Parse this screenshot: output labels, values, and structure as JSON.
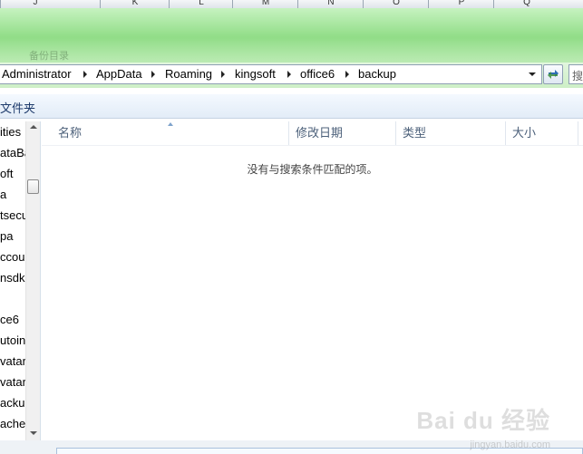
{
  "spreadsheet": {
    "columns": [
      "J",
      "K",
      "L",
      "M",
      "N",
      "O",
      "P",
      "Q"
    ]
  },
  "window": {
    "title_blurred": "备份目录"
  },
  "address_bar": {
    "crumbs": [
      "Administrator",
      "AppData",
      "Roaming",
      "kingsoft",
      "office6",
      "backup"
    ],
    "search_partial": "搜"
  },
  "toolbar": {
    "label": "文件夹"
  },
  "nav_pane": {
    "items": [
      "ities",
      "ataBa",
      "oft",
      "a",
      "tsecu",
      "pa",
      "ccoun",
      "nsdk",
      "",
      "ce6",
      "utoin",
      "vatar",
      "vatar",
      "ackup",
      "ache"
    ]
  },
  "file_list": {
    "columns": [
      "名称",
      "修改日期",
      "类型",
      "大小"
    ],
    "empty_message": "没有与搜索条件匹配的项。"
  },
  "watermark": {
    "text": "Bai du 经验",
    "sub": "jingyan.baidu.com"
  }
}
